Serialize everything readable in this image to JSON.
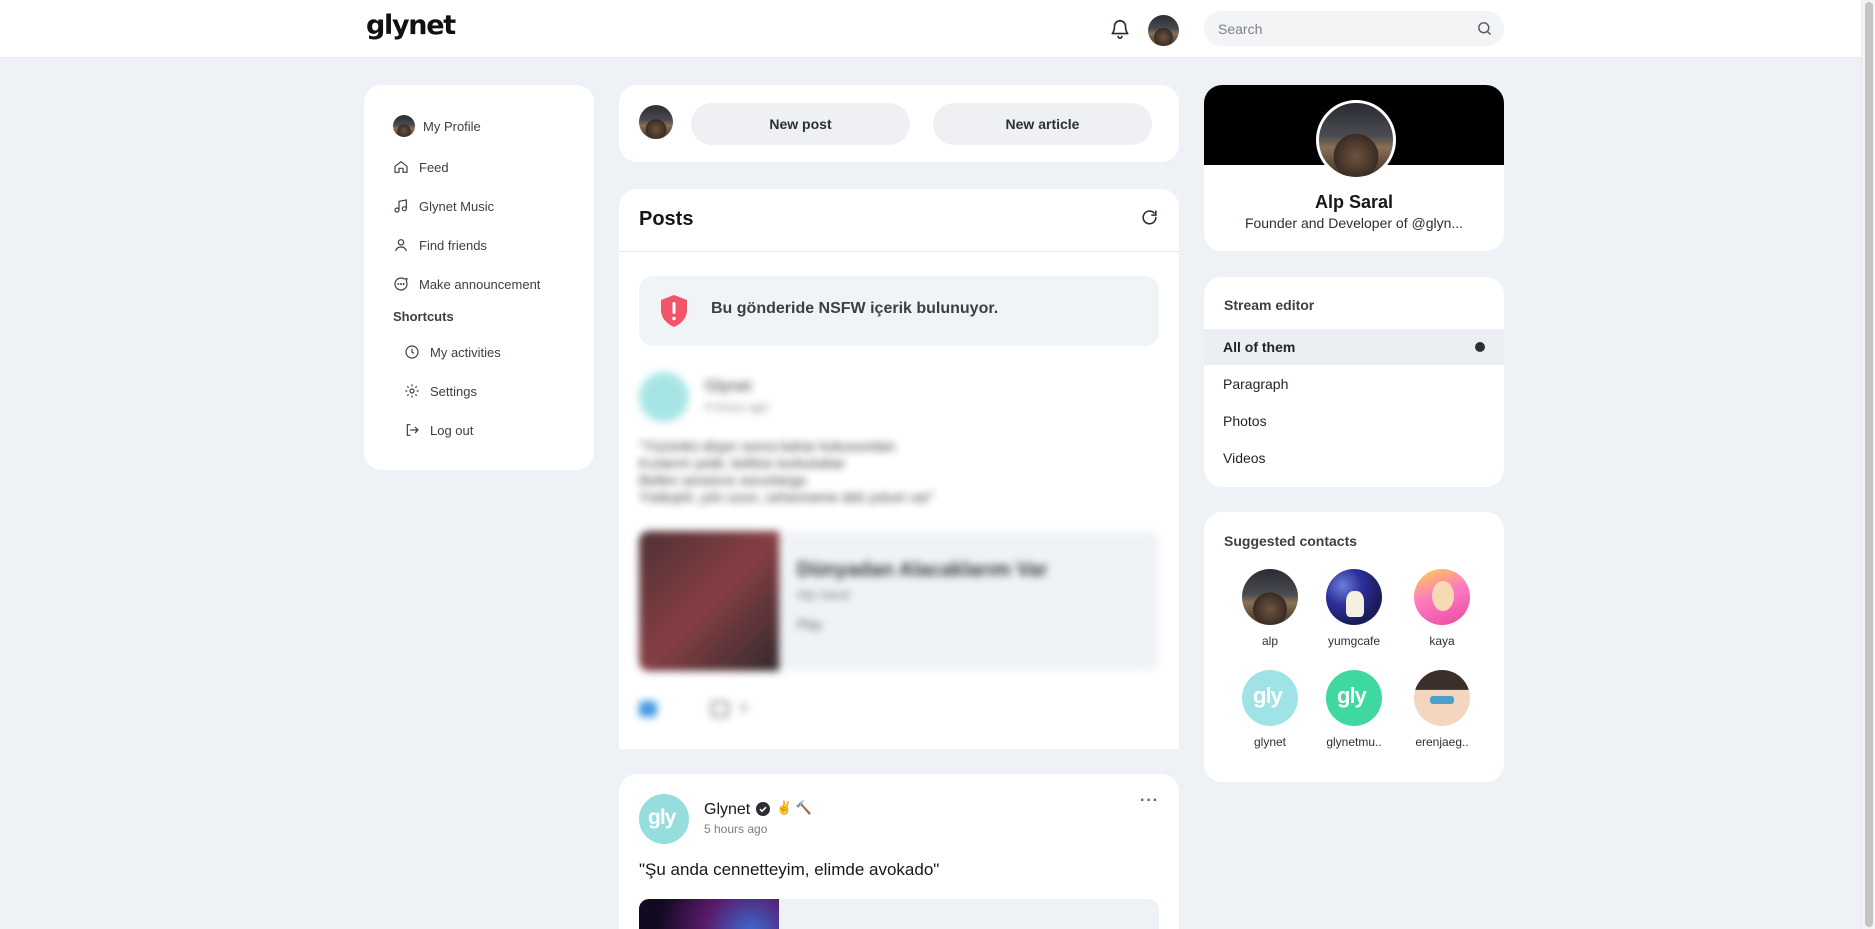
{
  "header": {
    "logo": "glynet",
    "search_placeholder": "Search"
  },
  "nav": {
    "profile_label": "My Profile",
    "feed_label": "Feed",
    "music_label": "Glynet Music",
    "friends_label": "Find friends",
    "announce_label": "Make announcement",
    "shortcuts_heading": "Shortcuts",
    "activities_label": "My activities",
    "settings_label": "Settings",
    "logout_label": "Log out"
  },
  "composer": {
    "new_post_label": "New post",
    "new_article_label": "New article"
  },
  "posts": {
    "title": "Posts",
    "nsfw_notice": "Bu gönderide NSFW içerik bulunuyor.",
    "blurred_post": {
      "author": "Glynet",
      "time": "4 hours ago",
      "text_lines": [
        "\"Yüzünkü düşer sonra bahar kokusundan",
        "Kızlarım yedir, bellisiz korkuluklar",
        "Bellen sessizce sorunlarga",
        "Yüdeşirli, yön uzun, cehenneme dek yolum var\""
      ],
      "song_title": "Dünyadan Alacaklarım Var",
      "song_artist": "Alp Saral",
      "song_play": "Play",
      "comment_count": "0"
    },
    "post2": {
      "author": "Glynet",
      "badges": "✌ 🔨",
      "time": "5 hours ago",
      "text": "\"Şu anda cennetteyim, elimde avokado\"",
      "more": "···"
    }
  },
  "profile": {
    "name": "Alp Saral",
    "bio": "Founder and Developer of @glyn..."
  },
  "stream_editor": {
    "title": "Stream editor",
    "items": [
      "All of them",
      "Paragraph",
      "Photos",
      "Videos"
    ],
    "active_index": 0
  },
  "suggested": {
    "title": "Suggested contacts",
    "contacts": [
      "alp",
      "yumgcafe",
      "kaya",
      "glynet",
      "glynetmu..",
      "erenjaeg.."
    ]
  }
}
